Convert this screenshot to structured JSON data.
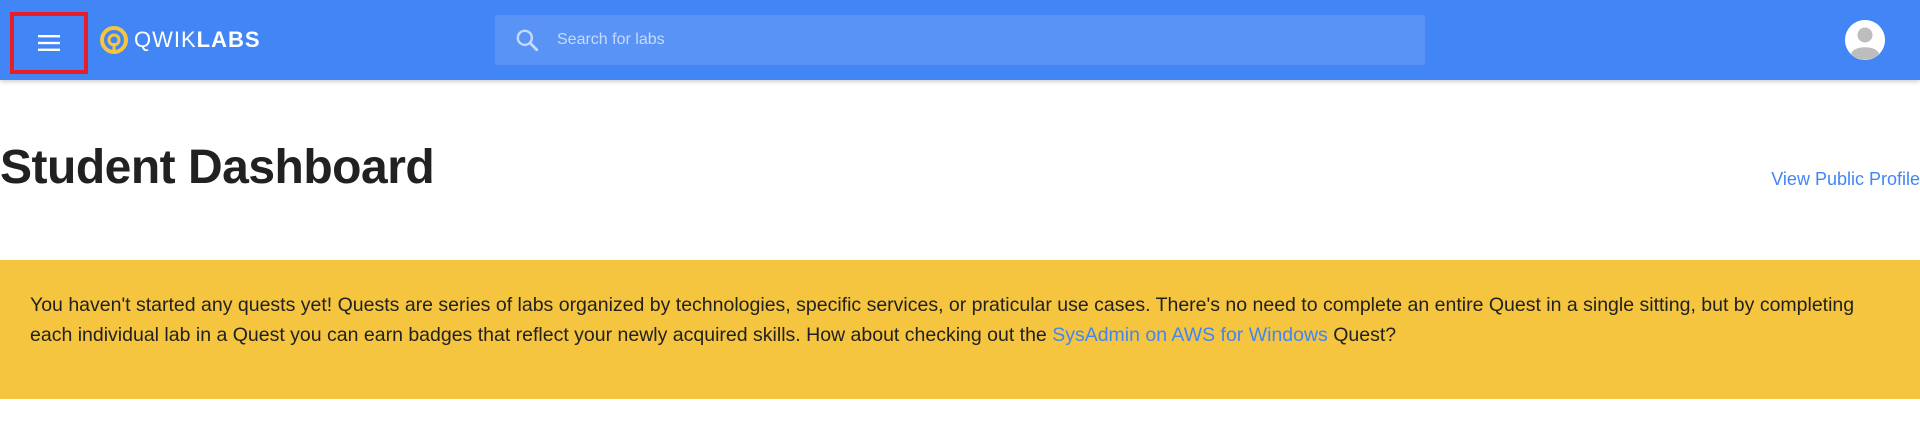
{
  "header": {
    "logo": {
      "text_light": "QWIK",
      "text_bold": "LABS"
    },
    "search": {
      "placeholder": "Search for labs",
      "value": ""
    },
    "icons": {
      "menu": "menu-icon",
      "search": "search-icon",
      "avatar": "user-avatar-icon"
    },
    "highlight_color": "#e3202a",
    "bar_color": "#4285f4"
  },
  "page": {
    "title": "Student Dashboard",
    "profile_link": "View Public Profile"
  },
  "notice": {
    "text_before": "You haven't started any quests yet! Quests are series of labs organized by technologies, specific services, or praticular use cases. There's no need to complete an entire Quest in a single sitting, but by completing each individual lab in a Quest you can earn badges that reflect your newly acquired skills. How about checking out the ",
    "link": "SysAdmin on AWS for Windows",
    "text_after": " Quest?",
    "background_color": "#f6c53f",
    "link_color": "#4285f4"
  }
}
